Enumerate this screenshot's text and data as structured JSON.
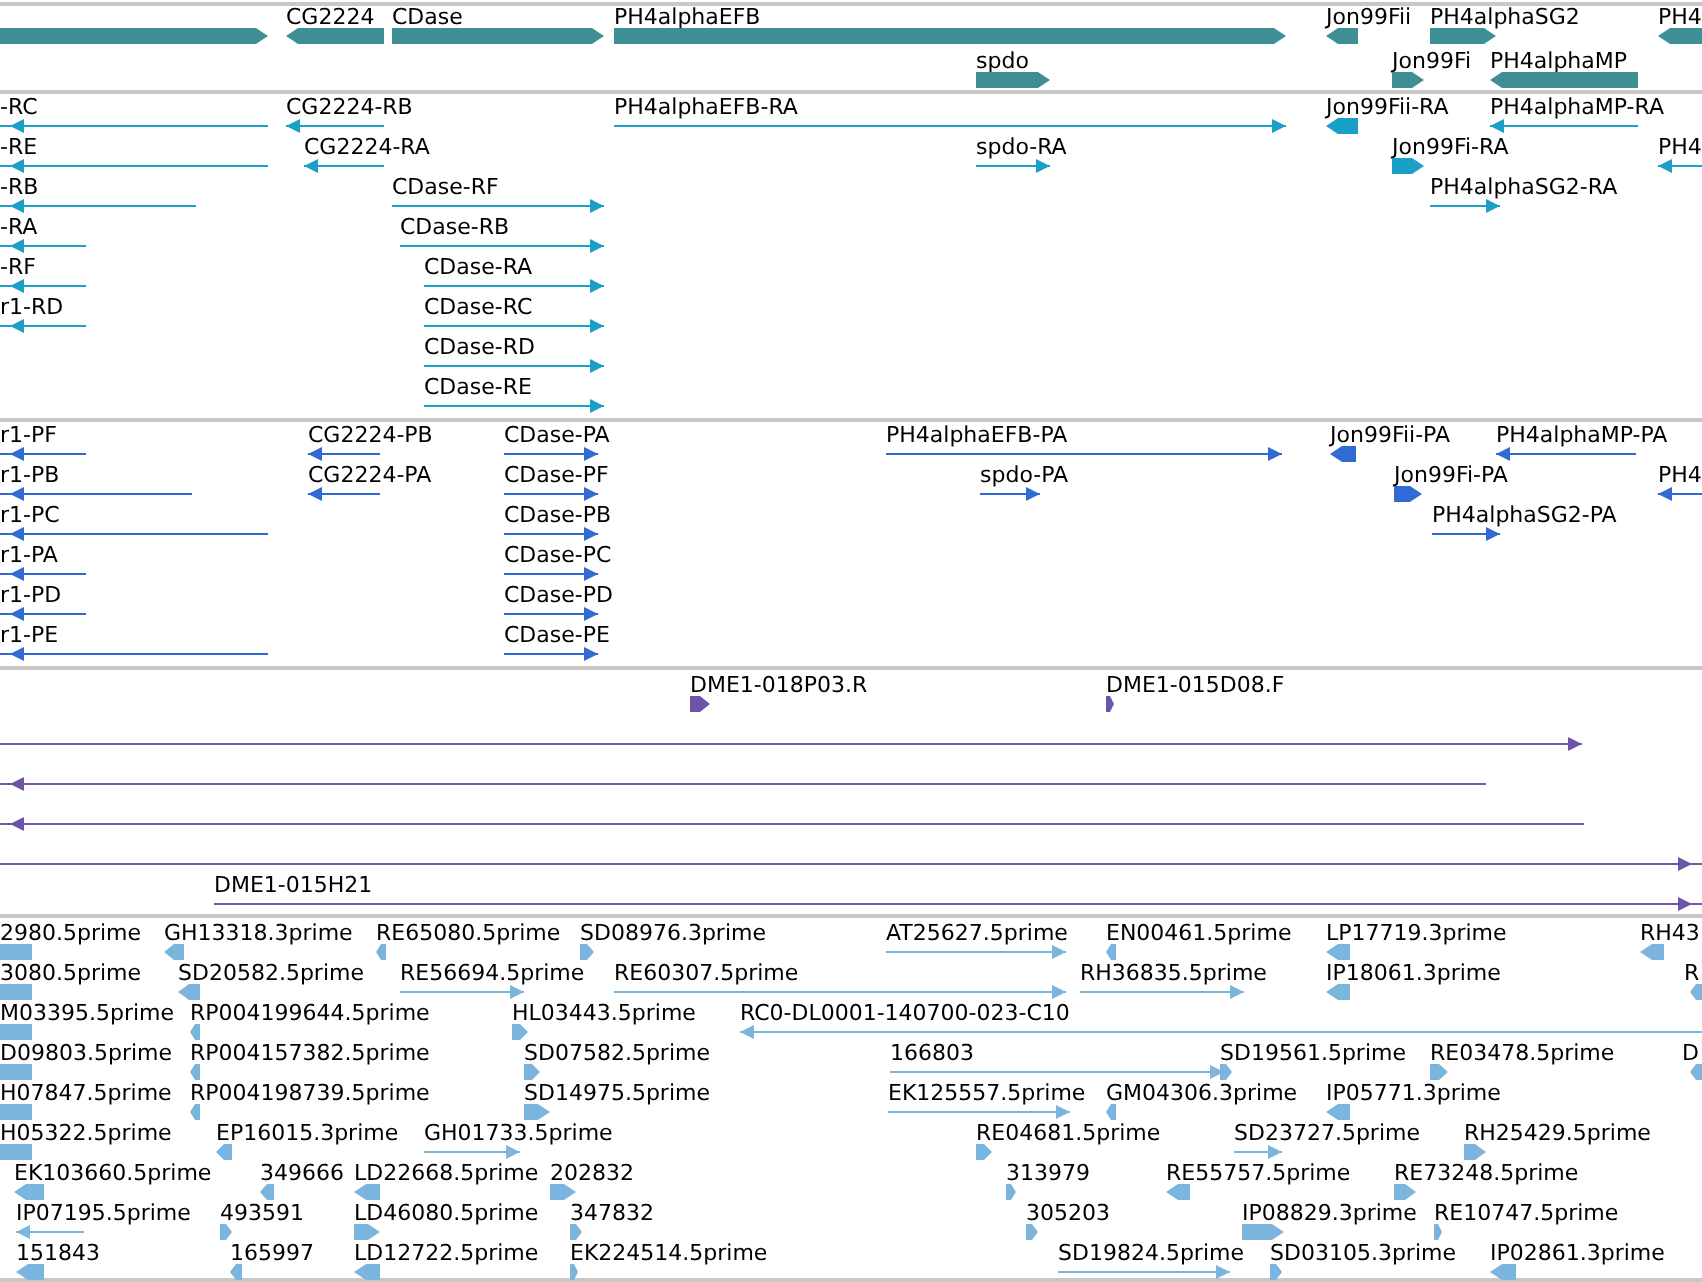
{
  "tracks": [
    {
      "kind": "gene",
      "features": [
        {
          "reverse": false
        },
        {
          "label": "CG2224",
          "reverse": true
        },
        {
          "label": "CDase",
          "reverse": false
        },
        {
          "label": "PH4alphaEFB",
          "reverse": false
        },
        {
          "label": "Jon99Fii",
          "reverse": true
        },
        {
          "label": "PH4alphaSG2",
          "reverse": false
        },
        {
          "label": "PH4",
          "reverse": true
        },
        {
          "label": "spdo",
          "reverse": false
        },
        {
          "label": "Jon99Fi",
          "reverse": false
        },
        {
          "label": "PH4alphaMP",
          "reverse": true
        }
      ]
    },
    {
      "kind": "transcript",
      "features": [
        {
          "label": "-RC",
          "reverse": true
        },
        {
          "label": "CG2224-RB",
          "reverse": true
        },
        {
          "label": "PH4alphaEFB-RA",
          "reverse": false
        },
        {
          "label": "Jon99Fii-RA",
          "reverse": true
        },
        {
          "label": "PH4alphaMP-RA",
          "reverse": true
        },
        {
          "label": "-RE",
          "reverse": true
        },
        {
          "label": "CG2224-RA",
          "reverse": true
        },
        {
          "label": "spdo-RA",
          "reverse": false
        },
        {
          "label": "Jon99Fi-RA",
          "reverse": false
        },
        {
          "label": "PH4",
          "reverse": true
        },
        {
          "label": "-RB",
          "reverse": true
        },
        {
          "label": "CDase-RF",
          "reverse": false
        },
        {
          "label": "PH4alphaSG2-RA",
          "reverse": false
        },
        {
          "label": "-RA",
          "reverse": true
        },
        {
          "label": "CDase-RB",
          "reverse": false
        },
        {
          "label": "-RF",
          "reverse": true
        },
        {
          "label": "CDase-RA",
          "reverse": false
        },
        {
          "label": "r1-RD",
          "reverse": true
        },
        {
          "label": "CDase-RC",
          "reverse": false
        },
        {
          "label": "CDase-RD",
          "reverse": false
        },
        {
          "label": "CDase-RE",
          "reverse": false
        }
      ]
    },
    {
      "kind": "protein",
      "features": [
        {
          "label": "r1-PF",
          "reverse": true
        },
        {
          "label": "CG2224-PB",
          "reverse": true
        },
        {
          "label": "CDase-PA",
          "reverse": false
        },
        {
          "label": "PH4alphaEFB-PA",
          "reverse": false
        },
        {
          "label": "Jon99Fii-PA",
          "reverse": true
        },
        {
          "label": "PH4alphaMP-PA",
          "reverse": true
        },
        {
          "label": "r1-PB",
          "reverse": true
        },
        {
          "label": "CG2224-PA",
          "reverse": true
        },
        {
          "label": "CDase-PF",
          "reverse": false
        },
        {
          "label": "spdo-PA",
          "reverse": false
        },
        {
          "label": "Jon99Fi-PA",
          "reverse": false
        },
        {
          "label": "PH4",
          "reverse": true
        },
        {
          "label": "r1-PC",
          "reverse": true
        },
        {
          "label": "CDase-PB",
          "reverse": false
        },
        {
          "label": "PH4alphaSG2-PA",
          "reverse": false
        },
        {
          "label": "r1-PA",
          "reverse": true
        },
        {
          "label": "CDase-PC",
          "reverse": false
        },
        {
          "label": "r1-PD",
          "reverse": true
        },
        {
          "label": "CDase-PD",
          "reverse": false
        },
        {
          "label": "r1-PE",
          "reverse": true
        },
        {
          "label": "CDase-PE",
          "reverse": false
        }
      ]
    },
    {
      "kind": "clone",
      "features": [
        {
          "label": "DME1-018P03.R",
          "reverse": false
        },
        {
          "label": "DME1-015D08.F",
          "reverse": false
        },
        {
          "reverse": false
        },
        {
          "reverse": true
        },
        {
          "reverse": true
        },
        {
          "reverse": false
        },
        {
          "label": "DME1-015H21",
          "reverse": false
        }
      ]
    },
    {
      "kind": "est",
      "features": [
        {
          "label": "2980.5prime",
          "reverse": true
        },
        {
          "label": "GH13318.3prime",
          "reverse": true
        },
        {
          "label": "RE65080.5prime",
          "reverse": true
        },
        {
          "label": "SD08976.3prime",
          "reverse": false
        },
        {
          "label": "AT25627.5prime",
          "reverse": false
        },
        {
          "label": "EN00461.5prime",
          "reverse": true
        },
        {
          "label": "LP17719.3prime",
          "reverse": true
        },
        {
          "label": "RH43",
          "reverse": true
        },
        {
          "label": "3080.5prime",
          "reverse": true
        },
        {
          "label": "SD20582.5prime",
          "reverse": true
        },
        {
          "label": "RE56694.5prime",
          "reverse": false
        },
        {
          "label": "RE60307.5prime",
          "reverse": false
        },
        {
          "label": "RH36835.5prime",
          "reverse": false
        },
        {
          "label": "IP18061.3prime",
          "reverse": true
        },
        {
          "label": "R",
          "reverse": true
        },
        {
          "label": "M03395.5prime",
          "reverse": true
        },
        {
          "label": "RP004199644.5prime",
          "reverse": true
        },
        {
          "label": "HL03443.5prime",
          "reverse": false
        },
        {
          "label": "RC0-DL0001-140700-023-C10",
          "reverse": true
        },
        {
          "label": "D09803.5prime",
          "reverse": true
        },
        {
          "label": "RP004157382.5prime",
          "reverse": true
        },
        {
          "label": "SD07582.5prime",
          "reverse": false
        },
        {
          "label": "166803",
          "reverse": false
        },
        {
          "label": "SD19561.5prime",
          "reverse": false
        },
        {
          "label": "RE03478.5prime",
          "reverse": false
        },
        {
          "label": "D",
          "reverse": true
        },
        {
          "label": "H07847.5prime",
          "reverse": true
        },
        {
          "label": "RP004198739.5prime",
          "reverse": true
        },
        {
          "label": "SD14975.5prime",
          "reverse": false
        },
        {
          "label": "EK125557.5prime",
          "reverse": false
        },
        {
          "label": "GM04306.3prime",
          "reverse": true
        },
        {
          "label": "IP05771.3prime",
          "reverse": true
        },
        {
          "label": "H05322.5prime",
          "reverse": true
        },
        {
          "label": "EP16015.3prime",
          "reverse": true
        },
        {
          "label": "GH01733.5prime",
          "reverse": false
        },
        {
          "label": "RE04681.5prime",
          "reverse": false
        },
        {
          "label": "SD23727.5prime",
          "reverse": false
        },
        {
          "label": "RH25429.5prime",
          "reverse": false
        },
        {
          "label": "EK103660.5prime",
          "reverse": true
        },
        {
          "label": "349666",
          "reverse": true
        },
        {
          "label": "LD22668.5prime",
          "reverse": true
        },
        {
          "label": "202832",
          "reverse": false
        },
        {
          "label": "313979",
          "reverse": false
        },
        {
          "label": "RE55757.5prime",
          "reverse": true
        },
        {
          "label": "RE73248.5prime",
          "reverse": false
        },
        {
          "label": "IP07195.5prime",
          "reverse": true
        },
        {
          "label": "493591",
          "reverse": false
        },
        {
          "label": "LD46080.5prime",
          "reverse": false
        },
        {
          "label": "347832",
          "reverse": false
        },
        {
          "label": "305203",
          "reverse": false
        },
        {
          "label": "IP08829.3prime",
          "reverse": false
        },
        {
          "label": "RE10747.5prime",
          "reverse": false
        },
        {
          "label": "151843",
          "reverse": true
        },
        {
          "label": "165997",
          "reverse": true
        },
        {
          "label": "LD12722.5prime",
          "reverse": true
        },
        {
          "label": "EK224514.5prime",
          "reverse": false
        },
        {
          "label": "SD19824.5prime",
          "reverse": false
        },
        {
          "label": "SD03105.3prime",
          "reverse": false
        },
        {
          "label": "IP02861.3prime",
          "reverse": true
        }
      ]
    }
  ]
}
